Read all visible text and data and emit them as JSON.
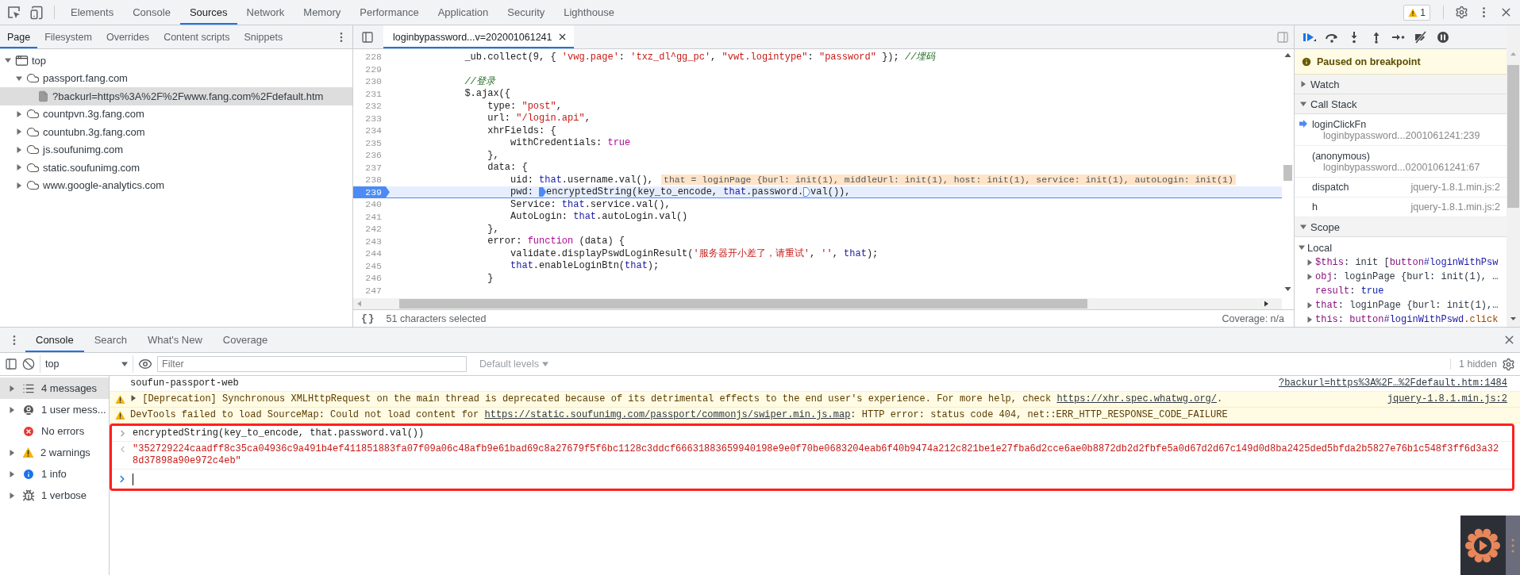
{
  "toolbar": {
    "tabs": [
      {
        "label": "Elements",
        "selected": false
      },
      {
        "label": "Console",
        "selected": false
      },
      {
        "label": "Sources",
        "selected": true
      },
      {
        "label": "Network",
        "selected": false
      },
      {
        "label": "Memory",
        "selected": false
      },
      {
        "label": "Performance",
        "selected": false
      },
      {
        "label": "Application",
        "selected": false
      },
      {
        "label": "Security",
        "selected": false
      },
      {
        "label": "Lighthouse",
        "selected": false
      }
    ],
    "warning_count": "1"
  },
  "navigator": {
    "tabs": [
      {
        "label": "Page",
        "selected": true
      },
      {
        "label": "Filesystem",
        "selected": false
      },
      {
        "label": "Overrides",
        "selected": false
      },
      {
        "label": "Content scripts",
        "selected": false
      },
      {
        "label": "Snippets",
        "selected": false
      }
    ],
    "tree": [
      {
        "kind": "frame",
        "label": "top",
        "expanded": true,
        "selected": false,
        "children": [
          {
            "kind": "domain",
            "label": "passport.fang.com",
            "expanded": true,
            "selected": false,
            "children": [
              {
                "kind": "file",
                "label": "?backurl=https%3A%2F%2Fwww.fang.com%2Fdefault.htm",
                "selected": true
              }
            ]
          },
          {
            "kind": "domain",
            "label": "countpvn.3g.fang.com",
            "expanded": false,
            "selected": false
          },
          {
            "kind": "domain",
            "label": "countubn.3g.fang.com",
            "expanded": false,
            "selected": false
          },
          {
            "kind": "domain",
            "label": "js.soufunimg.com",
            "expanded": false,
            "selected": false
          },
          {
            "kind": "domain",
            "label": "static.soufunimg.com",
            "expanded": false,
            "selected": false
          },
          {
            "kind": "domain",
            "label": "www.google-analytics.com",
            "expanded": false,
            "selected": false
          }
        ]
      }
    ]
  },
  "editor": {
    "tab": "loginbypassword...v=202001061241",
    "lines": [
      {
        "number": "228",
        "paused": false,
        "tokens": [
          {
            "kind": "text",
            "text": "            _ub.collect(9, { "
          },
          {
            "kind": "string",
            "text": "'vwg.page'"
          },
          {
            "kind": "text",
            "text": ": "
          },
          {
            "kind": "string",
            "text": "'txz_dl^gg_pc'"
          },
          {
            "kind": "text",
            "text": ", "
          },
          {
            "kind": "string",
            "text": "\"vwt.logintype\""
          },
          {
            "kind": "text",
            "text": ": "
          },
          {
            "kind": "string",
            "text": "\"password\""
          },
          {
            "kind": "text",
            "text": " }); "
          },
          {
            "kind": "comment",
            "text": "//埋码"
          }
        ]
      },
      {
        "number": "229",
        "paused": false
      },
      {
        "number": "230",
        "paused": false,
        "tokens": [
          {
            "kind": "comment",
            "text": "            //登录"
          }
        ]
      },
      {
        "number": "231",
        "paused": false,
        "tokens": [
          {
            "kind": "text",
            "text": "            $.ajax({"
          }
        ]
      },
      {
        "number": "232",
        "paused": false,
        "tokens": [
          {
            "kind": "text",
            "text": "                type: "
          },
          {
            "kind": "string",
            "text": "\"post\""
          },
          {
            "kind": "text",
            "text": ","
          }
        ]
      },
      {
        "number": "233",
        "paused": false,
        "tokens": [
          {
            "kind": "text",
            "text": "                url: "
          },
          {
            "kind": "string",
            "text": "\"/login.api\""
          },
          {
            "kind": "text",
            "text": ","
          }
        ]
      },
      {
        "number": "234",
        "paused": false,
        "tokens": [
          {
            "kind": "text",
            "text": "                xhrFields: {"
          }
        ]
      },
      {
        "number": "235",
        "paused": false,
        "tokens": [
          {
            "kind": "text",
            "text": "                    withCredentials: "
          },
          {
            "kind": "keyword",
            "text": "true"
          }
        ]
      },
      {
        "number": "236",
        "paused": false,
        "tokens": [
          {
            "kind": "text",
            "text": "                },"
          }
        ]
      },
      {
        "number": "237",
        "paused": false,
        "tokens": [
          {
            "kind": "text",
            "text": "                data: {"
          }
        ]
      },
      {
        "number": "238",
        "paused": false,
        "tokens": [
          {
            "kind": "text",
            "text": "                    uid: "
          },
          {
            "kind": "variable",
            "text": "that"
          },
          {
            "kind": "text",
            "text": ".username.val(),"
          },
          {
            "kind": "value",
            "text": "that = loginPage {burl: init(1), middleUrl: init(1), host: init(1), service: init(1), autoLogin: init(1)"
          }
        ]
      },
      {
        "number": "239",
        "paused": true,
        "tokens": [
          {
            "kind": "text",
            "text": "                    pwd: "
          },
          {
            "kind": "marker",
            "active": true
          },
          {
            "kind": "text",
            "text": "encryptedString(key_to_encode, "
          },
          {
            "kind": "variable",
            "text": "that"
          },
          {
            "kind": "text",
            "text": ".password."
          },
          {
            "kind": "marker",
            "active": false
          },
          {
            "kind": "text",
            "text": "val()),"
          }
        ]
      },
      {
        "number": "240",
        "paused": false,
        "tokens": [
          {
            "kind": "text",
            "text": "                    Service: "
          },
          {
            "kind": "variable",
            "text": "that"
          },
          {
            "kind": "text",
            "text": ".service.val(),"
          }
        ]
      },
      {
        "number": "241",
        "paused": false,
        "tokens": [
          {
            "kind": "text",
            "text": "                    AutoLogin: "
          },
          {
            "kind": "variable",
            "text": "that"
          },
          {
            "kind": "text",
            "text": ".autoLogin.val()"
          }
        ]
      },
      {
        "number": "242",
        "paused": false,
        "tokens": [
          {
            "kind": "text",
            "text": "                },"
          }
        ]
      },
      {
        "number": "243",
        "paused": false,
        "tokens": [
          {
            "kind": "text",
            "text": "                error: "
          },
          {
            "kind": "keyword",
            "text": "function"
          },
          {
            "kind": "text",
            "text": " (data) {"
          }
        ]
      },
      {
        "number": "244",
        "paused": false,
        "tokens": [
          {
            "kind": "text",
            "text": "                    validate.displayPswdLoginResult("
          },
          {
            "kind": "string",
            "text": "'服务器开小差了，请重试'"
          },
          {
            "kind": "text",
            "text": ", "
          },
          {
            "kind": "string",
            "text": "''"
          },
          {
            "kind": "text",
            "text": ", "
          },
          {
            "kind": "variable",
            "text": "that"
          },
          {
            "kind": "text",
            "text": ");"
          }
        ]
      },
      {
        "number": "245",
        "paused": false,
        "tokens": [
          {
            "kind": "variable",
            "text": "                    that"
          },
          {
            "kind": "text",
            "text": ".enableLoginBtn("
          },
          {
            "kind": "variable",
            "text": "that"
          },
          {
            "kind": "text",
            "text": ");"
          }
        ]
      },
      {
        "number": "246",
        "paused": false,
        "tokens": [
          {
            "kind": "text",
            "text": "                }"
          }
        ]
      },
      {
        "number": "247",
        "paused": false
      }
    ],
    "pretty_print": "{}",
    "status": "51 characters selected",
    "coverage": "Coverage: n/a"
  },
  "debugger": {
    "banner": "Paused on breakpoint",
    "watch": {
      "title": "Watch",
      "expanded": false
    },
    "call_stack": {
      "title": "Call Stack",
      "expanded": true,
      "frames": [
        {
          "kind": "wrapped",
          "name": "loginClickFn",
          "location": "loginbypassword...2001061241:239",
          "selected": true
        },
        {
          "kind": "wrapped",
          "name": "(anonymous)",
          "location": "loginbypassword...02001061241:67",
          "selected": false
        },
        {
          "kind": "inline",
          "name": "dispatch",
          "location": "jquery-1.8.1.min.js:2",
          "selected": false
        },
        {
          "kind": "inline",
          "name": "h",
          "location": "jquery-1.8.1.min.js:2",
          "selected": false
        }
      ]
    },
    "scope": {
      "title": "Scope",
      "expanded": true,
      "groups": [
        {
          "title": "Local",
          "expanded": true,
          "entries": [
            {
              "expandable": true,
              "tokens": [
                {
                  "kind": "name",
                  "text": "$this"
                },
                {
                  "kind": "plain",
                  "text": ": init ["
                },
                {
                  "kind": "node",
                  "text": "button"
                },
                {
                  "kind": "id",
                  "text": "#loginWithPsw"
                }
              ]
            },
            {
              "expandable": true,
              "tokens": [
                {
                  "kind": "name",
                  "text": "obj"
                },
                {
                  "kind": "plain",
                  "text": ": loginPage {burl: init(1), …"
                }
              ]
            },
            {
              "expandable": false,
              "tokens": [
                {
                  "kind": "name",
                  "text": "result"
                },
                {
                  "kind": "plain",
                  "text": ": "
                },
                {
                  "kind": "boolean",
                  "text": "true"
                }
              ]
            },
            {
              "expandable": true,
              "tokens": [
                {
                  "kind": "name",
                  "text": "that"
                },
                {
                  "kind": "plain",
                  "text": ": loginPage {burl: init(1),…"
                }
              ]
            },
            {
              "expandable": true,
              "tokens": [
                {
                  "kind": "name",
                  "text": "this"
                },
                {
                  "kind": "plain",
                  "text": ": "
                },
                {
                  "kind": "node",
                  "text": "button"
                },
                {
                  "kind": "id",
                  "text": "#loginWithPswd"
                },
                {
                  "kind": "class",
                  "text": ".click"
                }
              ]
            }
          ]
        }
      ]
    }
  },
  "drawer": {
    "tabs": [
      {
        "label": "Console",
        "selected": true
      },
      {
        "label": "Search",
        "selected": false
      },
      {
        "label": "What's New",
        "selected": false
      },
      {
        "label": "Coverage",
        "selected": false
      }
    ],
    "context": "top",
    "filter_placeholder": "Filter",
    "levels": {
      "label": "Default levels",
      "disabled": true
    },
    "hidden": "1 hidden",
    "sidebar": [
      {
        "kind": "messages",
        "label": "4 messages",
        "expandable": true,
        "selected": true
      },
      {
        "kind": "user",
        "label": "1 user mess...",
        "expandable": true,
        "selected": false
      },
      {
        "kind": "errors",
        "label": "No errors",
        "expandable": false,
        "selected": false
      },
      {
        "kind": "warnings",
        "label": "2 warnings",
        "expandable": true,
        "selected": false
      },
      {
        "kind": "info",
        "label": "1 info",
        "expandable": true,
        "selected": false
      },
      {
        "kind": "verbose",
        "label": "1 verbose",
        "expandable": true,
        "selected": false
      }
    ],
    "messages": [
      {
        "kind": "log",
        "expandable": false,
        "highlighted": false,
        "parts": [
          {
            "kind": "text",
            "text": "soufun-passport-web"
          }
        ],
        "source": "?backurl=https%3A%2F…%2Fdefault.htm:1484"
      },
      {
        "kind": "warning",
        "expandable": true,
        "highlighted": false,
        "parts": [
          {
            "kind": "text",
            "text": "[Deprecation] Synchronous XMLHttpRequest on the main thread is deprecated because of its detrimental effects to the end user's experience. For more help, check "
          },
          {
            "kind": "link",
            "text": "https://xhr.spec.whatwg.org/"
          },
          {
            "kind": "text",
            "text": "."
          }
        ],
        "source": "jquery-1.8.1.min.js:2"
      },
      {
        "kind": "warning",
        "expandable": false,
        "highlighted": false,
        "parts": [
          {
            "kind": "text",
            "text": "DevTools failed to load SourceMap: Could not load content for "
          },
          {
            "kind": "link",
            "text": "https://static.soufunimg.com/passport/commonjs/swiper.min.js.map"
          },
          {
            "kind": "text",
            "text": ": HTTP error: status code 404, net::ERR_HTTP_RESPONSE_CODE_FAILURE"
          }
        ]
      },
      {
        "kind": "input",
        "expandable": false,
        "highlighted": true,
        "parts": [
          {
            "kind": "text",
            "text": "encryptedString(key_to_encode, that.password.val())"
          }
        ]
      },
      {
        "kind": "result",
        "expandable": false,
        "highlighted": true,
        "parts": [
          {
            "kind": "text",
            "text": "\"352729224caadff8c35ca04936c9a491b4ef411851883fa07f09a06c48afb9e61bad69c8a27679f5f6bc1128c3ddcf66631883659940198e9e0f70be0683204eab6f40b9474a212c821be1e27fba6d2cce6ae0b8872db2d2fbfe5a0d67d2d67c149d0d8ba2425ded5bfda2b5827e76b1c548f3ff6d3a328d37898a90e972c4eb\""
          }
        ]
      },
      {
        "kind": "prompt",
        "highlighted": true
      }
    ]
  }
}
